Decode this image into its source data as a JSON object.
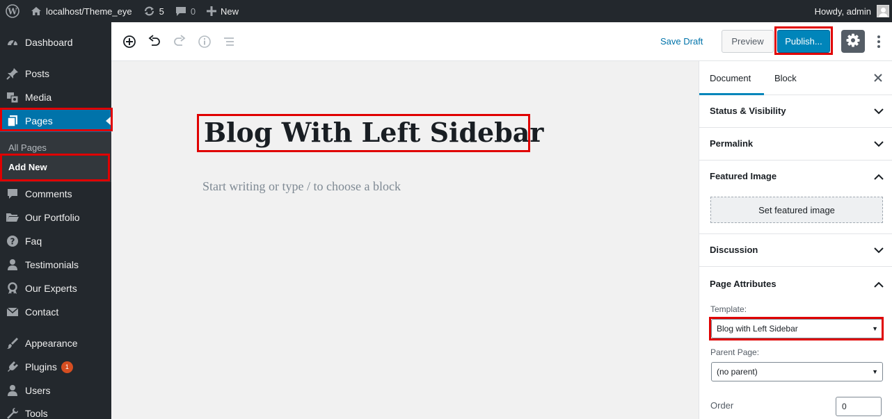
{
  "adminbar": {
    "site_name": "localhost/Theme_eye",
    "updates_count": "5",
    "comments_count": "0",
    "new_label": "New",
    "greeting": "Howdy, admin"
  },
  "menu": {
    "items": [
      {
        "label": "Dashboard",
        "icon": "dashboard-icon"
      },
      {
        "label": "Posts",
        "icon": "pin-icon"
      },
      {
        "label": "Media",
        "icon": "media-icon"
      },
      {
        "label": "Pages",
        "icon": "pages-icon"
      },
      {
        "label": "Comments",
        "icon": "comment-icon"
      },
      {
        "label": "Our Portfolio",
        "icon": "folder-icon"
      },
      {
        "label": "Faq",
        "icon": "help-icon"
      },
      {
        "label": "Testimonials",
        "icon": "user-icon"
      },
      {
        "label": "Our Experts",
        "icon": "award-icon"
      },
      {
        "label": "Contact",
        "icon": "mail-icon"
      },
      {
        "label": "Appearance",
        "icon": "brush-icon"
      },
      {
        "label": "Plugins",
        "icon": "plugin-icon"
      },
      {
        "label": "Users",
        "icon": "users-icon"
      },
      {
        "label": "Tools",
        "icon": "wrench-icon"
      }
    ],
    "submenu": [
      "All Pages",
      "Add New"
    ],
    "plugins_badge": "1"
  },
  "toolbar": {
    "save_draft": "Save Draft",
    "preview": "Preview",
    "publish": "Publish..."
  },
  "editor": {
    "title": "Blog With Left Sidebar",
    "placeholder": "Start writing or type / to choose a block"
  },
  "sidebar": {
    "tabs": [
      "Document",
      "Block"
    ],
    "panels": {
      "status": "Status & Visibility",
      "permalink": "Permalink",
      "featured_image": "Featured Image",
      "set_featured": "Set featured image",
      "discussion": "Discussion",
      "page_attributes": "Page Attributes"
    },
    "template_label": "Template:",
    "template_value": "Blog with Left Sidebar",
    "parent_label": "Parent Page:",
    "parent_value": "(no parent)",
    "order_label": "Order",
    "order_value": "0"
  },
  "colors": {
    "admin_dark": "#23282d",
    "accent_blue": "#0073aa",
    "highlight_red": "#e00000"
  }
}
